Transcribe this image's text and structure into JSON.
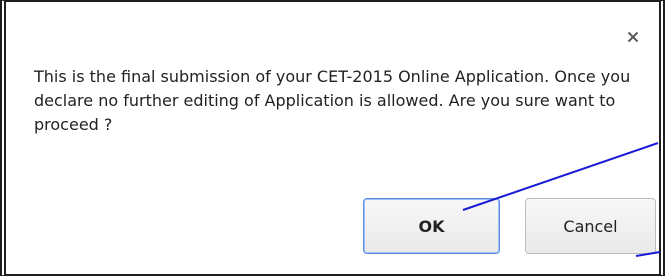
{
  "dialog": {
    "close_symbol": "×",
    "message": "This is the final submission of your CET-2015 Online Application. Once you declare no further editing of Application is allowed. Are you sure want to proceed ?",
    "ok_label": "OK",
    "cancel_label": "Cancel"
  },
  "colors": {
    "annotation_lines": "#1a1ad6",
    "ok_focus_border": "#5a8fe8",
    "frame": "#1e1e1e"
  },
  "icons": {
    "close": "close-icon"
  }
}
